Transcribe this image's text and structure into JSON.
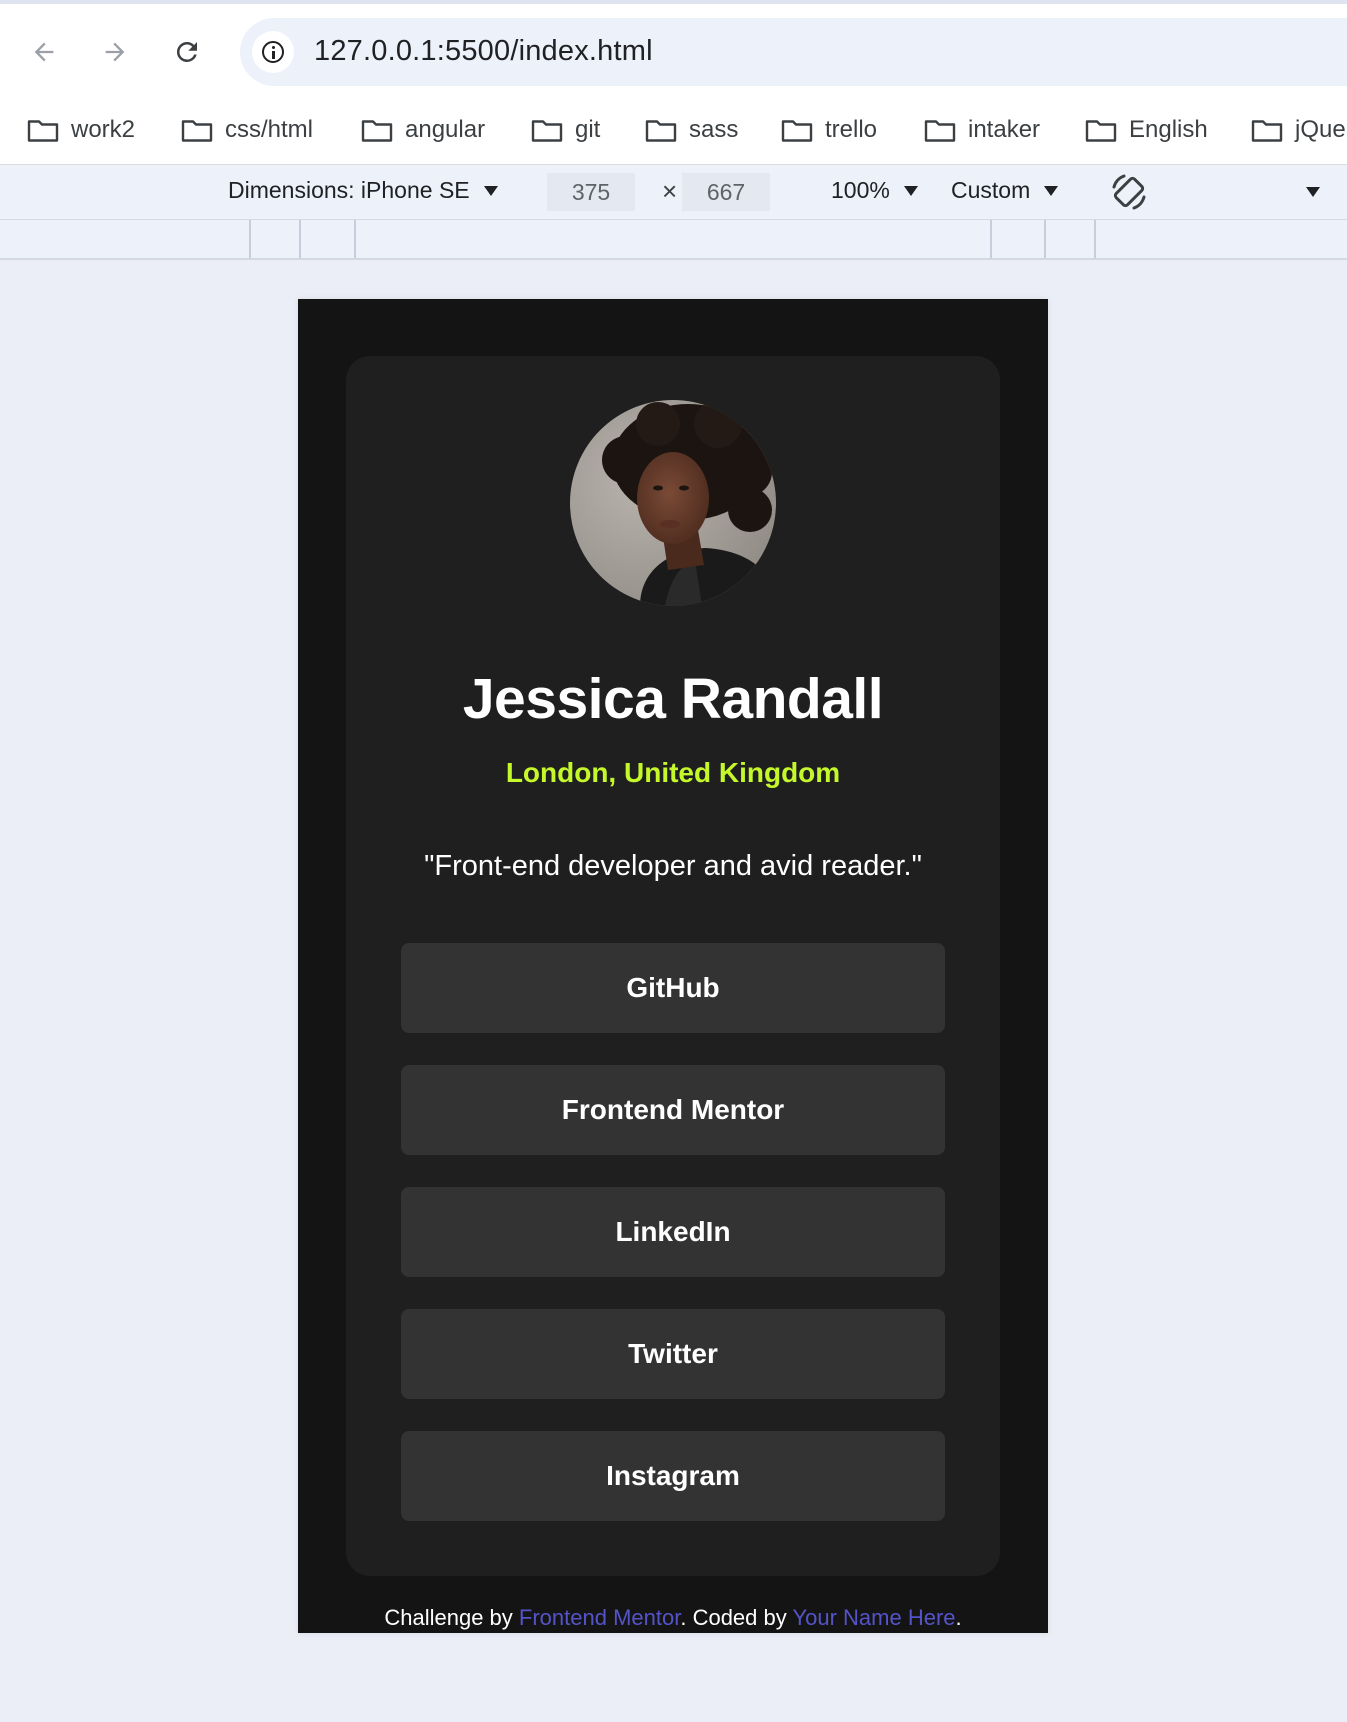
{
  "browser": {
    "url_host": "127.0.0.1",
    "url_path": ":5500/index.html",
    "nav": {
      "back_icon": "arrow-left-icon",
      "forward_icon": "arrow-right-icon",
      "reload_icon": "reload-icon"
    }
  },
  "bookmarks": [
    {
      "label": "work2"
    },
    {
      "label": "css/html"
    },
    {
      "label": "angular"
    },
    {
      "label": "git"
    },
    {
      "label": "sass"
    },
    {
      "label": "trello"
    },
    {
      "label": "intaker"
    },
    {
      "label": "English"
    },
    {
      "label": "jQue"
    }
  ],
  "devtools": {
    "dimensions_label": "Dimensions: iPhone SE",
    "width_value": "375",
    "height_value": "667",
    "times_symbol": "×",
    "zoom": "100%",
    "throttle": "Custom"
  },
  "profile": {
    "name": "Jessica Randall",
    "location": "London, United Kingdom",
    "bio": "\"Front-end developer and avid reader.\""
  },
  "links": [
    {
      "label": "GitHub"
    },
    {
      "label": "Frontend Mentor"
    },
    {
      "label": "LinkedIn"
    },
    {
      "label": "Twitter"
    },
    {
      "label": "Instagram"
    }
  ],
  "attribution": {
    "prefix": "Challenge by ",
    "challenge_link": "Frontend Mentor",
    "middle": ". Coded by ",
    "author_link": "Your Name Here",
    "suffix": "."
  },
  "colors": {
    "page_bg": "#141414",
    "card_bg": "#1f1f1f",
    "button_bg": "#333333",
    "accent_green": "#c4f82a",
    "link_blue": "#5454c8"
  }
}
